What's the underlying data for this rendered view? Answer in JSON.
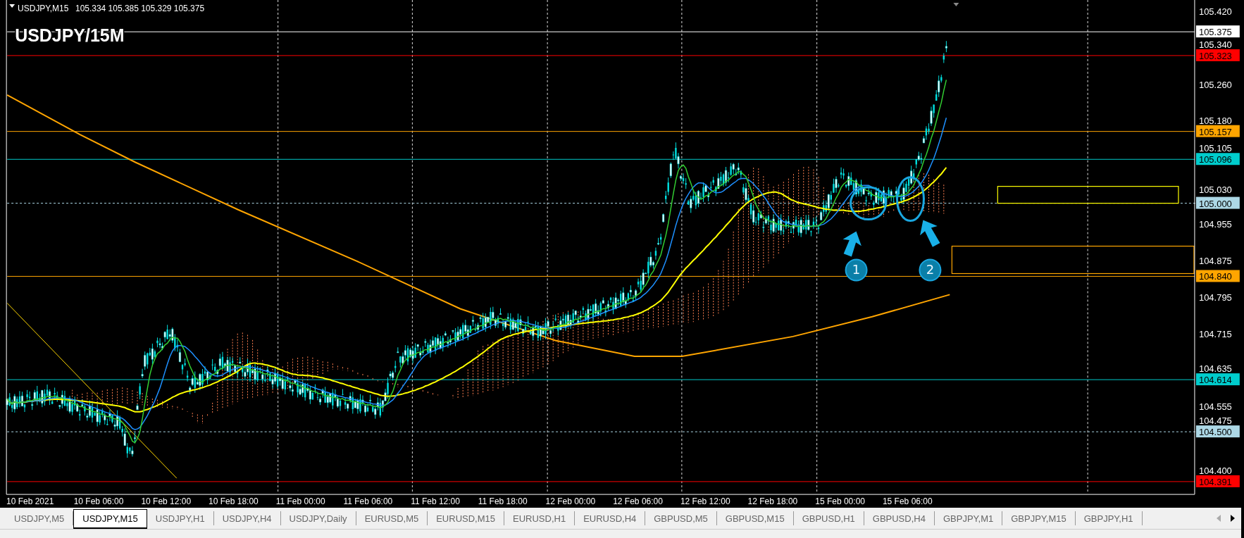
{
  "header": {
    "symbol": "USDJPY,M15",
    "ohlc": [
      "105.334",
      "105.385",
      "105.329",
      "105.375"
    ]
  },
  "chart_title": "USDJPY/15M",
  "price_ticks": [
    "105.420",
    "105.340",
    "105.260",
    "105.180",
    "105.105",
    "105.030",
    "104.955",
    "104.875",
    "104.795",
    "104.715",
    "104.635",
    "104.555",
    "104.475",
    "104.400"
  ],
  "price_lines": [
    {
      "label": "105.375",
      "color": "#ffffff",
      "kind": "solid"
    },
    {
      "label": "105.323",
      "color": "#ff0000",
      "kind": "solid"
    },
    {
      "label": "105.157",
      "color": "#ffa500",
      "kind": "solid"
    },
    {
      "label": "105.096",
      "color": "#00cccc",
      "kind": "solid"
    },
    {
      "label": "105.000",
      "color": "#add8e6",
      "kind": "dashed"
    },
    {
      "label": "104.840",
      "color": "#ffa500",
      "kind": "solid"
    },
    {
      "label": "104.614",
      "color": "#00cccc",
      "kind": "solid"
    },
    {
      "label": "104.500",
      "color": "#add8e6",
      "kind": "dashed"
    },
    {
      "label": "104.391",
      "color": "#ff0000",
      "kind": "solid"
    }
  ],
  "markers": [
    {
      "label": "1"
    },
    {
      "label": "2"
    }
  ],
  "time_labels": [
    "10 Feb 2021",
    "10 Feb 06:00",
    "10 Feb 12:00",
    "10 Feb 18:00",
    "11 Feb 00:00",
    "11 Feb 06:00",
    "11 Feb 12:00",
    "11 Feb 18:00",
    "12 Feb 00:00",
    "12 Feb 06:00",
    "12 Feb 12:00",
    "12 Feb 18:00",
    "15 Feb 00:00",
    "15 Feb 06:00"
  ],
  "tabs": [
    {
      "label": "USDJPY,M5",
      "selected": false
    },
    {
      "label": "USDJPY,M15",
      "selected": true
    },
    {
      "label": "USDJPY,H1",
      "selected": false
    },
    {
      "label": "USDJPY,H4",
      "selected": false
    },
    {
      "label": "USDJPY,Daily",
      "selected": false
    },
    {
      "label": "EURUSD,M5",
      "selected": false
    },
    {
      "label": "EURUSD,M15",
      "selected": false
    },
    {
      "label": "EURUSD,H1",
      "selected": false
    },
    {
      "label": "EURUSD,H4",
      "selected": false
    },
    {
      "label": "GBPUSD,M5",
      "selected": false
    },
    {
      "label": "GBPUSD,M15",
      "selected": false
    },
    {
      "label": "GBPUSD,H1",
      "selected": false
    },
    {
      "label": "GBPUSD,H4",
      "selected": false
    },
    {
      "label": "GBPJPY,M1",
      "selected": false
    },
    {
      "label": "GBPJPY,M15",
      "selected": false
    },
    {
      "label": "GBPJPY,H1",
      "selected": false
    }
  ]
}
